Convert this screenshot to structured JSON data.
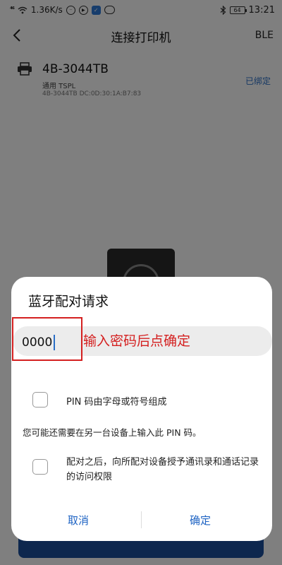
{
  "status_bar": {
    "signal": "⁴⁶",
    "net_speed": "1.36K/s",
    "battery": "64",
    "time": "13:21"
  },
  "header": {
    "title": "连接打印机",
    "ble": "BLE"
  },
  "device": {
    "name": "4B-3044TB",
    "type": "通用  TSPL",
    "mac": "4B-3044TB  DC:0D:30:1A:B7:83",
    "status": "已绑定"
  },
  "dialog": {
    "title": "蓝牙配对请求",
    "pin_value": "0000",
    "annotation": "输入密码后点确定",
    "checkbox_pin_label": "PIN 码由字母或符号组成",
    "info": "您可能还需要在另一台设备上输入此 PIN 码。",
    "checkbox_contacts_label": "配对之后，向所配对设备授予通讯录和通话记录的访问权限",
    "cancel": "取消",
    "confirm": "确定"
  },
  "colors": {
    "accent": "#1e63c3",
    "annotation": "#d42020",
    "primary_bar": "#1b4f9c"
  }
}
